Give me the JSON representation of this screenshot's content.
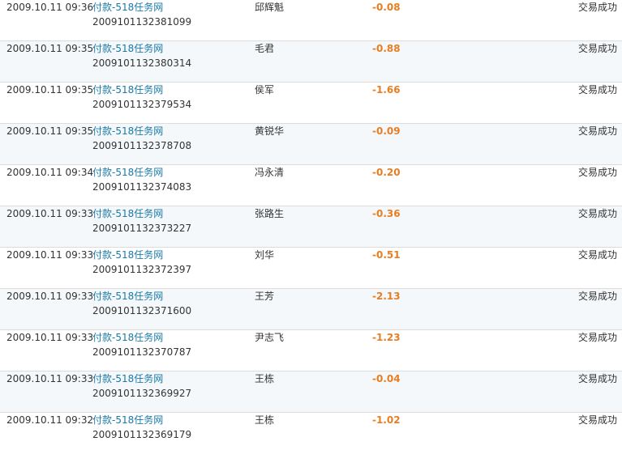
{
  "records": [
    {
      "time": "2009.10.11 09:36",
      "title": "付款-518任务网",
      "txn": "2009101132381099",
      "party": "邱辉魁",
      "amount": "-0.08",
      "status": "交易成功"
    },
    {
      "time": "2009.10.11 09:35",
      "title": "付款-518任务网",
      "txn": "2009101132380314",
      "party": "毛君",
      "amount": "-0.88",
      "status": "交易成功"
    },
    {
      "time": "2009.10.11 09:35",
      "title": "付款-518任务网",
      "txn": "2009101132379534",
      "party": "侯军",
      "amount": "-1.66",
      "status": "交易成功"
    },
    {
      "time": "2009.10.11 09:35",
      "title": "付款-518任务网",
      "txn": "2009101132378708",
      "party": "黄锐华",
      "amount": "-0.09",
      "status": "交易成功"
    },
    {
      "time": "2009.10.11 09:34",
      "title": "付款-518任务网",
      "txn": "2009101132374083",
      "party": "冯永清",
      "amount": "-0.20",
      "status": "交易成功"
    },
    {
      "time": "2009.10.11 09:33",
      "title": "付款-518任务网",
      "txn": "2009101132373227",
      "party": "张路生",
      "amount": "-0.36",
      "status": "交易成功"
    },
    {
      "time": "2009.10.11 09:33",
      "title": "付款-518任务网",
      "txn": "2009101132372397",
      "party": "刘华",
      "amount": "-0.51",
      "status": "交易成功"
    },
    {
      "time": "2009.10.11 09:33",
      "title": "付款-518任务网",
      "txn": "2009101132371600",
      "party": "王芳",
      "amount": "-2.13",
      "status": "交易成功"
    },
    {
      "time": "2009.10.11 09:33",
      "title": "付款-518任务网",
      "txn": "2009101132370787",
      "party": "尹志飞",
      "amount": "-1.23",
      "status": "交易成功"
    },
    {
      "time": "2009.10.11 09:33",
      "title": "付款-518任务网",
      "txn": "2009101132369927",
      "party": "王栋",
      "amount": "-0.04",
      "status": "交易成功"
    },
    {
      "time": "2009.10.11 09:32",
      "title": "付款-518任务网",
      "txn": "2009101132369179",
      "party": "王栋",
      "amount": "-1.02",
      "status": "交易成功"
    }
  ],
  "colors": {
    "link": "#1a7aa6",
    "amount": "#e77e22",
    "row_alt_bg": "#f4f8fb",
    "divider": "#dcdcdc"
  }
}
